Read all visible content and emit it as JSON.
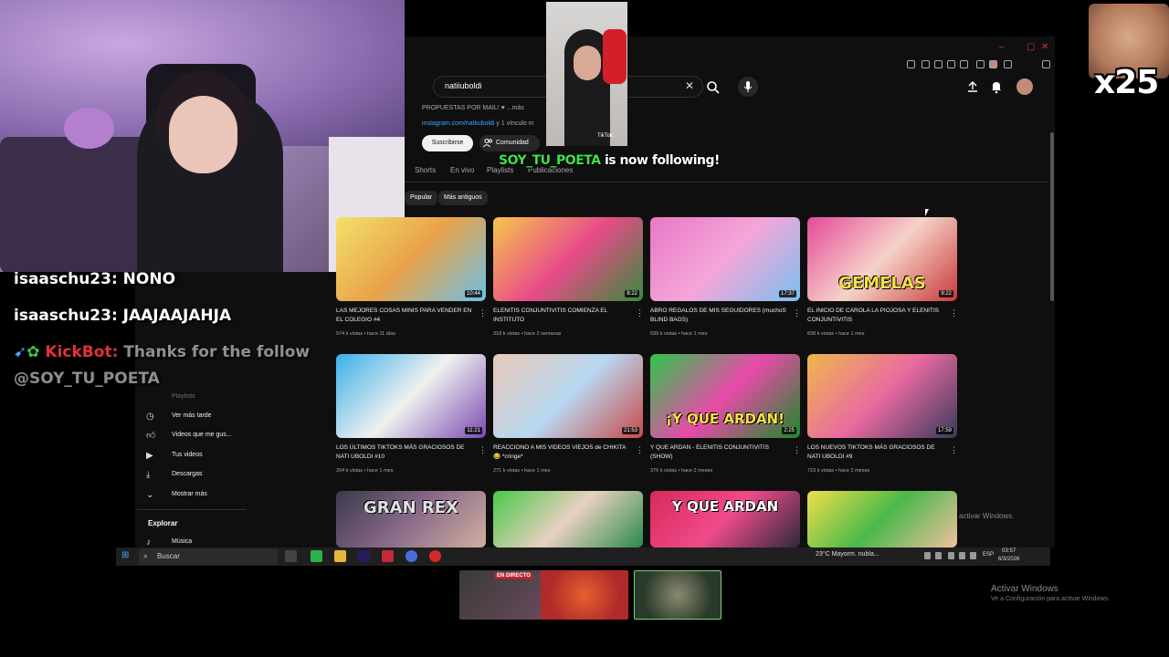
{
  "chat": {
    "lines": [
      {
        "user": "isaaschu23: ",
        "msg": "NONO"
      },
      {
        "user": "isaaschu23: ",
        "msg": "JAAJAAJAHJA"
      },
      {
        "bot": "KickBot: ",
        "msg": "Thanks for the follow"
      },
      {
        "msg": "@SOY_TU_POETA"
      }
    ]
  },
  "alert": {
    "user": "SOY_TU_POETA",
    "text": " is now following!"
  },
  "emote": {
    "multiplier": "x25"
  },
  "tiktok": {
    "watermark": "TikTok"
  },
  "youtube": {
    "search_value": "natiiuboldi",
    "channel_desc": "PROPUESTAS POR MAIL! ♥ ...más",
    "channel_link": "instagram.com/natiiuboldi",
    "channel_link_rest": " y 1 vínculo m",
    "subscribe": "Suscribirse",
    "community": "Comunidad",
    "tabs": [
      "Shorts",
      "En vivo",
      "Playlists",
      "Publicaciones"
    ],
    "chips": [
      "Popular",
      "Más antiguos"
    ],
    "videos": [
      {
        "title": "LAS MEJORES COSAS MINIS PARA VENDER EN EL COLEGIO #4",
        "meta": "974 k vistas • hace 11 días",
        "duration": "10:44",
        "overlay": ""
      },
      {
        "title": "ELENITIS CONJUNTIVITIS COMIENZA EL INSTITUTO",
        "meta": "318 k vistas • hace 2 semanas",
        "duration": "8:22",
        "overlay": ""
      },
      {
        "title": "ABRO REGALOS DE MIS SEGUIDORES (muchoS BLIND BAGS)",
        "meta": "539 k vistas • hace 1 mes",
        "duration": "17:37",
        "overlay": ""
      },
      {
        "title": "EL INICIO DE CAROLA LA PIOJOSA Y ELENITIS CONJUNTIVITIS",
        "meta": "838 k vistas • hace 1 mes",
        "duration": "9:22",
        "overlay": "GEMELAS"
      },
      {
        "title": "LOS ÚLTIMOS TIKTOKS MÁS GRACIOSOS DE NATI UBOLDI #10",
        "meta": "204 k vistas • hace 1 mes",
        "duration": "11:21",
        "overlay": ""
      },
      {
        "title": "REACCIONO A MIS VIDEOS VIEJOS de CHIKITA 😂 *cringe*",
        "meta": "271 k vistas • hace 1 mes",
        "duration": "21:53",
        "overlay": ""
      },
      {
        "title": "Y QUE ARDAN - ELENITIS CONJUNTIVITIS (SHOW)",
        "meta": "376 k vistas • hace 2 meses",
        "duration": "2:25",
        "overlay": "¡Y QUE ARDAN!"
      },
      {
        "title": "LOS NUEVOS TIKTOKS MÁS GRACIOSOS DE NATI UBOLDI #9",
        "meta": "723 k vistas • hace 2 meses",
        "duration": "17:59",
        "overlay": ""
      },
      {
        "title": "",
        "meta": "",
        "duration": "",
        "overlay": "GRAN REX"
      },
      {
        "title": "",
        "meta": "",
        "duration": "",
        "overlay": ""
      },
      {
        "title": "",
        "meta": "",
        "duration": "",
        "overlay": "Y QUE ARDAN"
      },
      {
        "title": "",
        "meta": "",
        "duration": "",
        "overlay": ""
      }
    ],
    "sidebar": [
      {
        "icon": "clock-icon",
        "label": "Ver más tarde"
      },
      {
        "icon": "thumbs-up-icon",
        "label": "Videos que me gus..."
      },
      {
        "icon": "play-icon",
        "label": "Tus videos"
      },
      {
        "icon": "download-icon",
        "label": "Descargas"
      },
      {
        "icon": "chevron-down-icon",
        "label": "Mostrar más"
      },
      {
        "icon": "music-icon",
        "label": "Música"
      }
    ],
    "sidebar_faded": [
      "Playlists"
    ],
    "explore": "Explorar"
  },
  "taskbar": {
    "search": "Buscar",
    "weather": "23°C  Mayorm. nubla...",
    "lang": "ESP",
    "time": "03:57",
    "date": "6/3/2026"
  },
  "windows": {
    "activate_small": "activar Windows.",
    "activate": "Activar Windows",
    "activate_sub": "Ve a Configuración para activar Windows."
  },
  "preview": {
    "live_badge": "EN DIRECTO"
  },
  "colors": {
    "bg": "#0f0f0f",
    "alert_user": "#3ee24a",
    "kickbot": "#e0323c"
  }
}
